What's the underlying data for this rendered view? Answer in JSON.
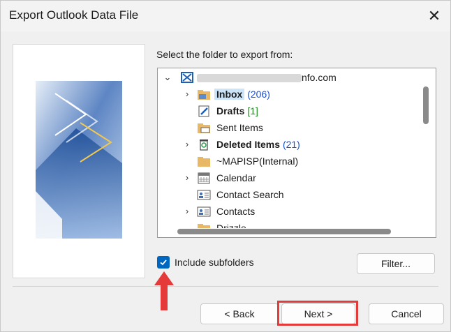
{
  "window": {
    "title": "Export Outlook Data File"
  },
  "prompt": "Select the folder to export from:",
  "tree": {
    "account": "nfo.com",
    "items": [
      {
        "label": "Inbox",
        "count": "(206)"
      },
      {
        "label": "Drafts",
        "count": "[1]"
      },
      {
        "label": "Sent Items"
      },
      {
        "label": "Deleted Items",
        "count": "(21)"
      },
      {
        "label": "~MAPISP(Internal)"
      },
      {
        "label": "Calendar"
      },
      {
        "label": "Contact Search"
      },
      {
        "label": "Contacts"
      },
      {
        "label": "Drizzle"
      }
    ]
  },
  "options": {
    "include_subfolders": "Include subfolders",
    "include_subfolders_checked": true
  },
  "buttons": {
    "filter": "Filter...",
    "back": "< Back",
    "next": "Next >",
    "cancel": "Cancel"
  },
  "colors": {
    "accent": "#0067c0",
    "highlight": "#e53a3a",
    "selection": "#cce4f7"
  }
}
